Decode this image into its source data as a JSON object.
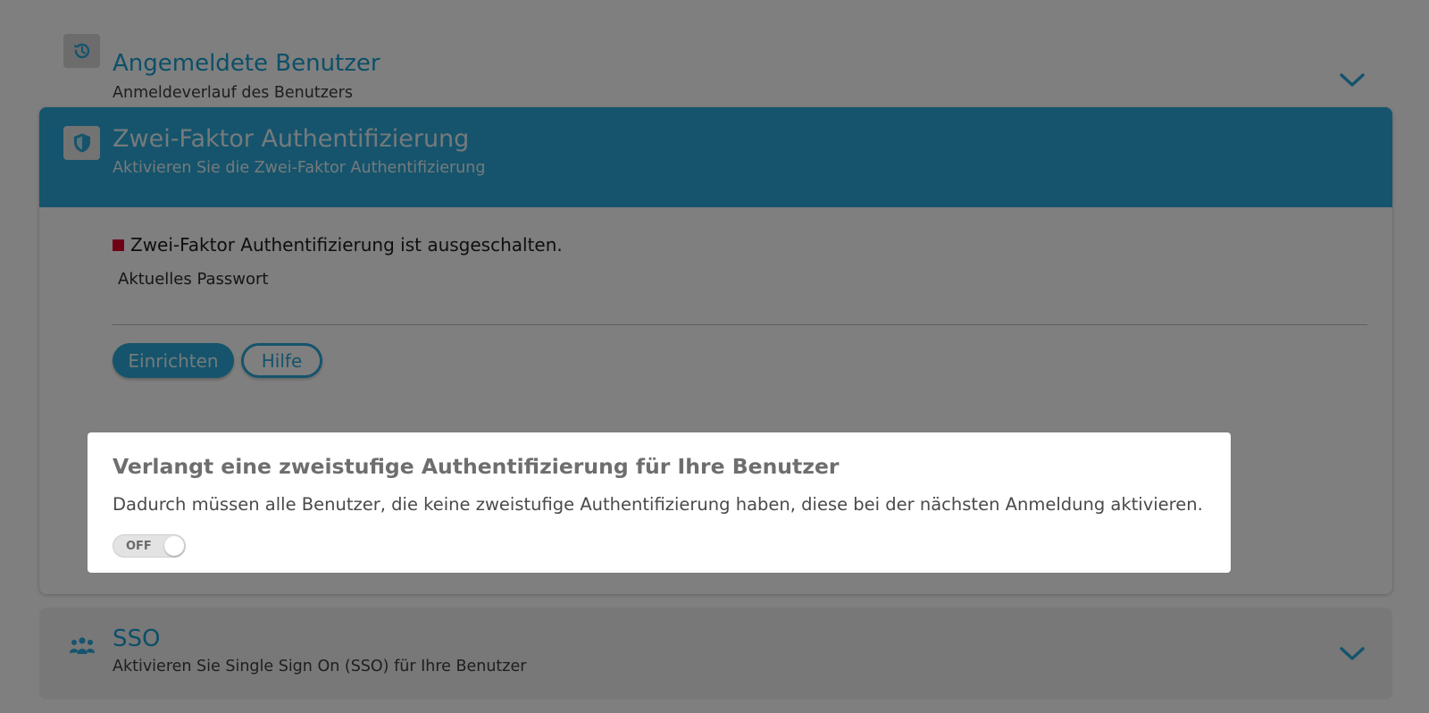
{
  "sections": {
    "logins": {
      "title": "Angemeldete Benutzer",
      "subtitle": "Anmeldeverlauf des Benutzers",
      "icon": "history-icon"
    },
    "two_factor": {
      "title": "Zwei-Faktor Authentifizierung",
      "subtitle": "Aktivieren Sie die Zwei-Faktor Authentifizierung",
      "icon": "shield-icon",
      "status_text": "Zwei-Faktor Authentifizierung ist ausgeschalten.",
      "status_color": "#e0002b",
      "password_label": "Aktuelles Passwort",
      "password_value": "",
      "setup_button": "Einrichten",
      "help_button": "Hilfe"
    },
    "sso": {
      "title": "SSO",
      "subtitle": "Aktivieren Sie Single Sign On (SSO) für Ihre Benutzer",
      "icon": "users-group-icon"
    }
  },
  "spotlight": {
    "title": "Verlangt eine zweistufige Authentifizierung für Ihre Benutzer",
    "description": "Dadurch müssen alle Benutzer, die keine zweistufige Authentifizierung haben, diese bei der nächsten Anmeldung aktivieren.",
    "toggle_label": "OFF",
    "toggle_on": false
  },
  "colors": {
    "accent": "#2aa8d8",
    "overlay": "rgba(0,0,0,0.5)"
  }
}
